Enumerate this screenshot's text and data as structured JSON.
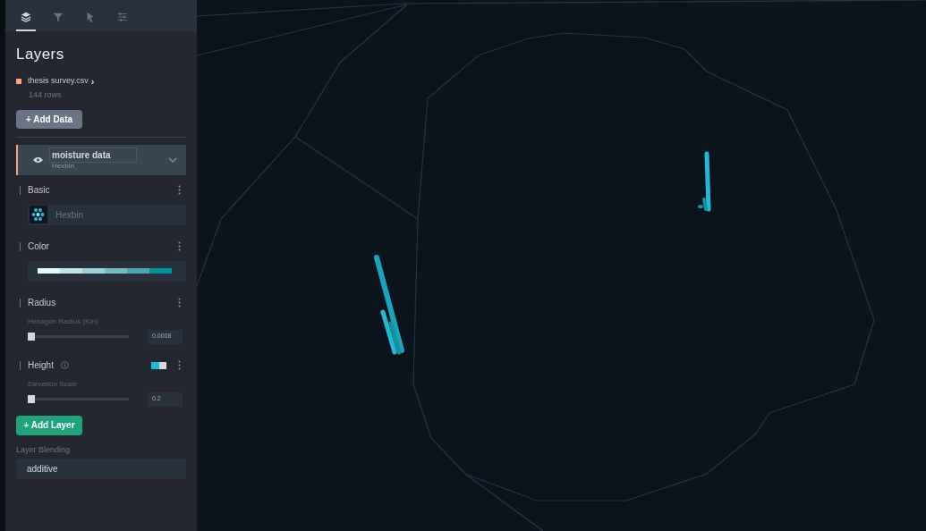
{
  "sidebar": {
    "tabs": [
      {
        "kind": "layers",
        "selected": true
      },
      {
        "kind": "filters",
        "selected": false
      },
      {
        "kind": "interactions",
        "selected": false
      },
      {
        "kind": "map-settings",
        "selected": false
      }
    ],
    "title": "Layers",
    "dataset": {
      "name": "thesis survey.csv",
      "color": "#f4a582",
      "arrow": "›",
      "rows": "144 rows"
    },
    "add_data_button": "+ Add Data",
    "layer": {
      "name": "moisture data",
      "type": "Hexbin",
      "visible": true,
      "color": "#f4a582",
      "sections": [
        {
          "kind": "basic",
          "title": "Basic",
          "layer_type": "Hexbin"
        },
        {
          "kind": "color",
          "title": "Color",
          "palette": [
            {
              "color": "#e6fafa"
            },
            {
              "color": "#c1e5e6"
            },
            {
              "color": "#9dd0d4"
            },
            {
              "color": "#75bbc1"
            },
            {
              "color": "#4ba7af"
            },
            {
              "color": "#00939c"
            }
          ]
        },
        {
          "kind": "slider",
          "title": "Radius",
          "label": "Hexagon Radius (Km)",
          "level": 0,
          "value": "0.0008"
        },
        {
          "kind": "slider",
          "title": "Height",
          "info": true,
          "toggle_on": true,
          "label": "Elevation Scale",
          "level": 0,
          "value": "0.2"
        }
      ]
    },
    "add_layer_button": "+ Add Layer",
    "blending": {
      "label": "Layer Blending",
      "value": "additive"
    }
  }
}
